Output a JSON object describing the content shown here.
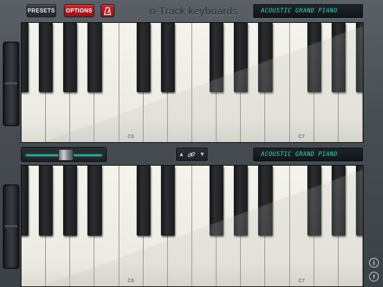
{
  "toolbar": {
    "presets_label": "PRESETS",
    "options_label": "OPTIONS",
    "metronome_icon": "metronome-icon"
  },
  "app_title": "n-Track keyboards",
  "top_keyboard": {
    "instrument": "ACOUSTIC GRAND PIANO",
    "octave_labels": [
      "C6",
      "C7"
    ]
  },
  "bottom_keyboard": {
    "instrument": "ACOUSTIC GRAND PIANO",
    "octave_labels": [
      "C6",
      "C7"
    ]
  },
  "split_slider": {
    "value_fraction": 0.53
  },
  "link_control": {
    "up_icon": "triangle-up-icon",
    "link_icon": "chain-link-icon",
    "down_icon": "triangle-down-icon"
  },
  "side_icons": [
    "info-icon",
    "facebook-icon"
  ],
  "colors": {
    "accent_red": "#c8242a",
    "lcd_text": "#37d9c9",
    "background": "#474c53"
  }
}
